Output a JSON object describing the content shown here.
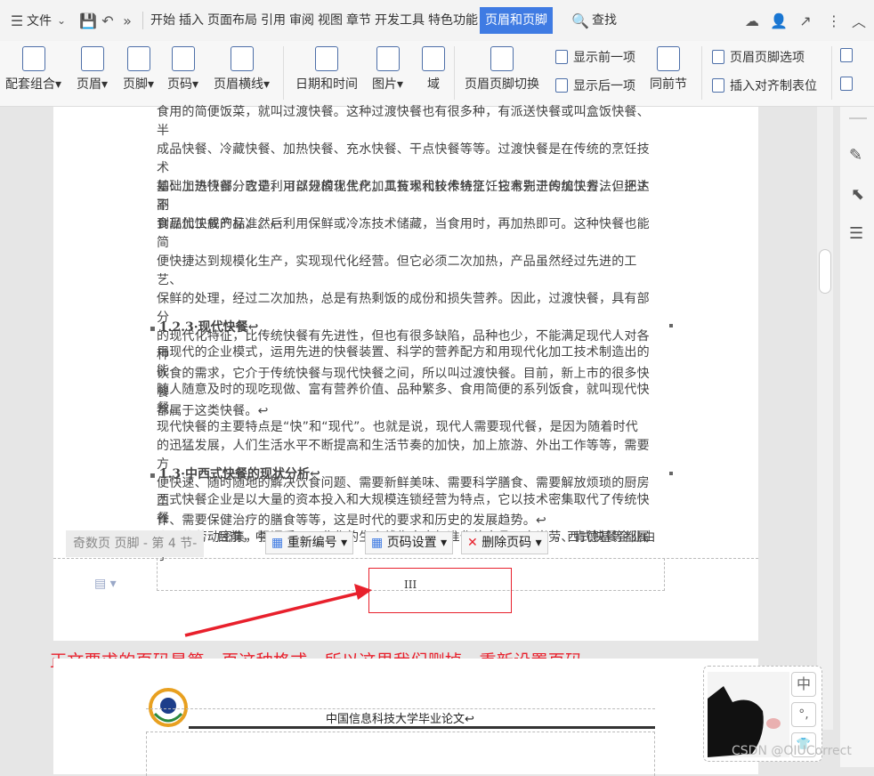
{
  "menubar": {
    "file": "文件",
    "tabs": [
      "开始",
      "插入",
      "页面布局",
      "引用",
      "审阅",
      "视图",
      "章节",
      "开发工具",
      "特色功能",
      "页眉和页脚"
    ],
    "active_tab": "页眉和页脚",
    "search": "查找"
  },
  "ribbon": {
    "items": [
      "配套组合",
      "页眉",
      "页脚",
      "页码",
      "页眉横线",
      "日期和时间",
      "图片",
      "域",
      "页眉页脚切换",
      "同前节"
    ],
    "small": [
      "显示前一项",
      "显示后一项",
      "页眉页脚选项",
      "插入对齐制表位"
    ]
  },
  "doc": {
    "para1": [
      "食用的简便饭菜，就叫过渡快餐。这种过渡快餐也有很多种，有派送快餐或叫盒饭快餐、半",
      "成品快餐、冷藏快餐、加热快餐、充水快餐、干点快餐等等。过渡快餐是在传统的烹饪技术",
      "基础上进行部分改造，可以规模化生产，具有现代技术特征，它有别于传统快餐，但还达不",
      "到现代快餐的标准。↩"
    ],
    "para2": [
      "如：加热快餐。它是利用部分的现代化加工技术和较传统烹饪技术先进的加工方法，把主副",
      "食品加工成产品，然后利用保鲜或冷冻技术储藏，当食用时，再加热即可。这种快餐也能简",
      "便快捷达到规模化生产，实现现代化经营。但它必须二次加热，产品虽然经过先进的工艺、",
      "保鲜的处理，经过二次加热，总是有热剩饭的成份和损失营养。因此，过渡快餐，具有部分",
      "的现代化特征，比传统快餐有先进性，但也有很多缺陷，品种也少，不能满足现代人对各种",
      "饮食的需求，它介于传统快餐与现代快餐之间，所以叫过渡快餐。目前，新上市的很多快餐",
      "都属于这类快餐。↩"
    ],
    "heading1": "1.2.3·现代快餐↩",
    "para3": [
      "用现代的企业模式，运用先进的快餐装置、科学的营养配方和用现代化加工技术制造出的能",
      "随人随意及时的现吃现做、富有营养价值、品种繁多、食用简便的系列饭食，就叫现代快餐。",
      "现代快餐的主要特点是“快”和“现代”。也就是说，现代人需要现代餐，是因为随着时代",
      "的迅猛发展，人们生活水平不断提高和生活节奏的加快，加上旅游、外出工作等等，需要方",
      "便快速、随时随地的解决饮食问题、需要新鲜美味、需要科学膳食、需要解放烦琐的厨房工",
      "作、需要保健治疗的膳食等等，这是时代的要求和历史的发展趋势。↩"
    ],
    "heading2": "1.3·中西式快餐的现状分析↩",
    "para4": [
      "西式快餐企业是以大量的资本投入和大规模连锁经营为特点，它以技术密集取代了传统快餐",
      "企业的劳动密集，强调采用工业化的生产线生产出标准化的产品，麦当劳、肯德基等都属于"
    ],
    "para4_tail_left": "目前，中",
    "para4_tail_right": "。西式快餐企业由"
  },
  "footer_bar": {
    "label": "奇数页 页脚 - 第 4 节-",
    "renumber": "重新编号",
    "page_settings": "页码设置",
    "delete_page_num": "删除页码"
  },
  "page_number": "III",
  "annotation": "正文要求的页码是第一页这种格式，所以这里我们删掉，重新设置页码",
  "page2": {
    "header_title": "中国信息科技大学毕业论文↩"
  },
  "watermark": "CSDN @OIUCorrect",
  "thumb_btns": [
    "中",
    "°,",
    "👕"
  ],
  "colors": {
    "accent": "#3f7be3",
    "annotation": "#e8202c"
  }
}
